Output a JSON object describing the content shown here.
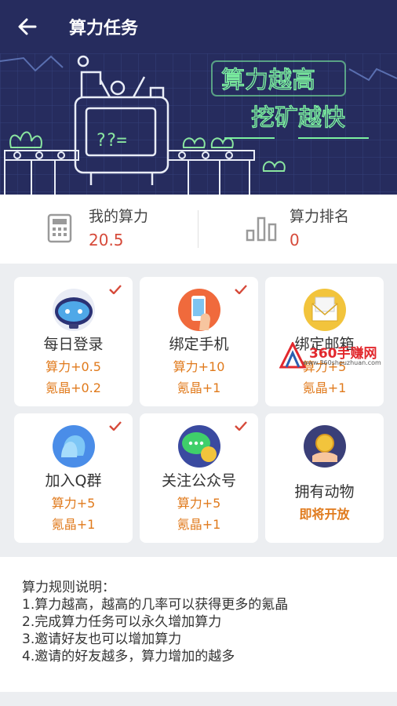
{
  "header": {
    "title": "算力任务",
    "back_icon": "arrow-left-icon"
  },
  "banner": {
    "line1": "算力越高",
    "line2": "挖矿越快",
    "machine_text": "??="
  },
  "stats": [
    {
      "label": "我的算力",
      "value": "20.5",
      "icon": "calculator-icon"
    },
    {
      "label": "算力排名",
      "value": "0",
      "icon": "bar-chart-icon"
    }
  ],
  "tasks": [
    {
      "name": "每日登录",
      "line1": "算力+0.5",
      "line2": "氪晶+0.2",
      "done": true
    },
    {
      "name": "绑定手机",
      "line1": "算力+10",
      "line2": "氪晶+1",
      "done": true
    },
    {
      "name": "绑定邮箱",
      "line1": "算力+5",
      "line2": "氪晶+1",
      "done": false
    },
    {
      "name": "加入Q群",
      "line1": "算力+5",
      "line2": "氪晶+1",
      "done": true
    },
    {
      "name": "关注公众号",
      "line1": "算力+5",
      "line2": "氪晶+1",
      "done": true
    },
    {
      "name": "拥有动物",
      "line1": "即将开放",
      "done": false
    }
  ],
  "rules": {
    "title": "算力规则说明：",
    "items": [
      "1.算力越高，越高的几率可以获得更多的氪晶",
      "2.完成算力任务可以永久增加算力",
      "3.邀请好友也可以增加算力",
      "4.邀请的好友越多，算力增加的越多"
    ]
  },
  "watermark": {
    "text": "360手赚网",
    "sub": "www.360shouzhuan.com"
  },
  "colors": {
    "header_bg": "#262c5e",
    "accent_red": "#d64a3a",
    "reward_orange": "#e07a1c",
    "neon_green": "#7cf0a0"
  }
}
